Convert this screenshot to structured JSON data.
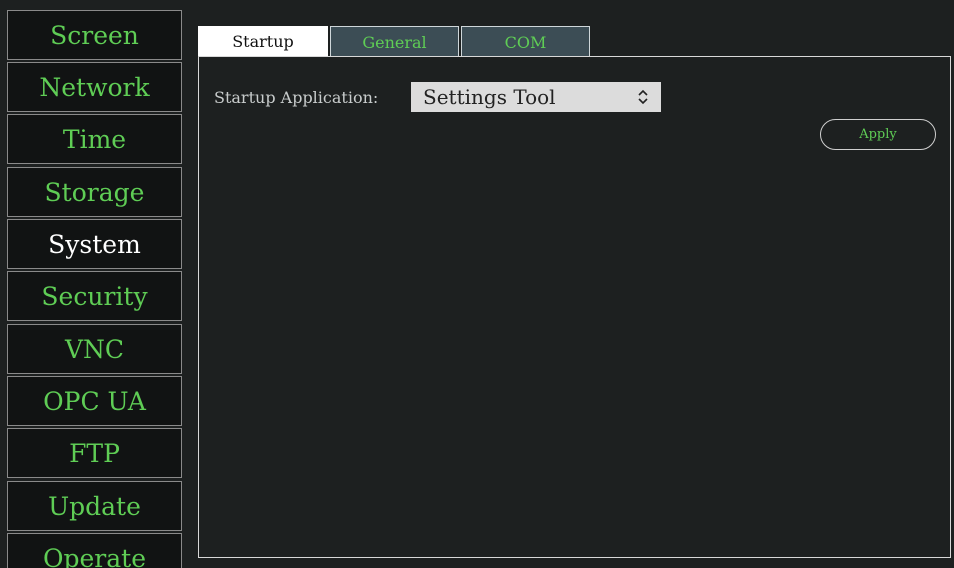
{
  "sidebar": {
    "items": [
      {
        "label": "Screen",
        "active": false
      },
      {
        "label": "Network",
        "active": false
      },
      {
        "label": "Time",
        "active": false
      },
      {
        "label": "Storage",
        "active": false
      },
      {
        "label": "System",
        "active": true
      },
      {
        "label": "Security",
        "active": false
      },
      {
        "label": "VNC",
        "active": false
      },
      {
        "label": "OPC UA",
        "active": false
      },
      {
        "label": "FTP",
        "active": false
      },
      {
        "label": "Update",
        "active": false
      },
      {
        "label": "Operate",
        "active": false
      }
    ]
  },
  "tabs": [
    {
      "label": "Startup",
      "active": true
    },
    {
      "label": "General",
      "active": false
    },
    {
      "label": "COM",
      "active": false
    }
  ],
  "startup": {
    "app_label": "Startup Application:",
    "app_value": "Settings Tool",
    "apply_label": "Apply"
  },
  "colors": {
    "accent_green": "#5fcd55",
    "background": "#1d2020",
    "inactive_tab": "#3c4d55"
  }
}
